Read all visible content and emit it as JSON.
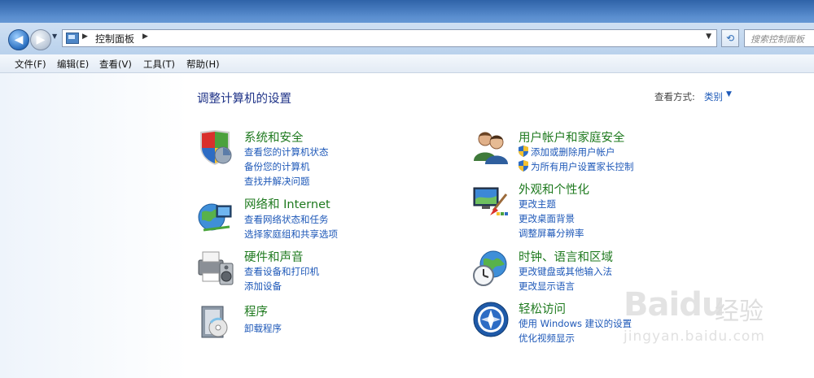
{
  "address": {
    "path": "控制面板",
    "search_placeholder": "搜索控制面板"
  },
  "menu": [
    "文件(F)",
    "编辑(E)",
    "查看(V)",
    "工具(T)",
    "帮助(H)"
  ],
  "main": {
    "title": "调整计算机的设置",
    "view_label": "查看方式:",
    "view_value": "类别"
  },
  "categories": [
    {
      "title": "系统和安全",
      "icon": "shield-icon",
      "links": [
        "查看您的计算机状态",
        "备份您的计算机",
        "查找并解决问题"
      ]
    },
    {
      "title": "网络和 Internet",
      "icon": "network-globe-icon",
      "links": [
        "查看网络状态和任务",
        "选择家庭组和共享选项"
      ]
    },
    {
      "title": "硬件和声音",
      "icon": "printer-speaker-icon",
      "links": [
        "查看设备和打印机",
        "添加设备"
      ]
    },
    {
      "title": "程序",
      "icon": "programs-box-icon",
      "links": [
        "卸载程序"
      ]
    },
    {
      "title": "用户帐户和家庭安全",
      "icon": "users-icon",
      "links": [
        "添加或删除用户帐户",
        "为所有用户设置家长控制"
      ]
    },
    {
      "title": "外观和个性化",
      "icon": "monitor-brush-icon",
      "links": [
        "更改主题",
        "更改桌面背景",
        "调整屏幕分辨率"
      ]
    },
    {
      "title": "时钟、语言和区域",
      "icon": "clock-globe-icon",
      "links": [
        "更改键盘或其他输入法",
        "更改显示语言"
      ]
    },
    {
      "title": "轻松访问",
      "icon": "ease-of-access-icon",
      "links": [
        "使用 Windows 建议的设置",
        "优化视频显示"
      ]
    }
  ],
  "watermark": {
    "logo": "Baidu",
    "text": "经验",
    "url": "jingyan.baidu.com"
  },
  "colors": {
    "category_title": "#1f7a1f",
    "link": "#1e58b8",
    "page_title": "#1e3287"
  }
}
